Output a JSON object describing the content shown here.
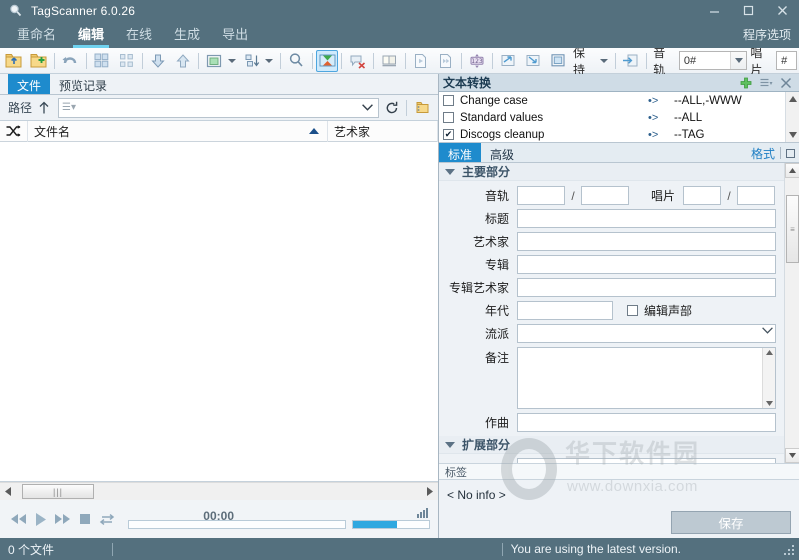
{
  "window": {
    "title": "TagScanner 6.0.26",
    "app_icon": "magnifier-icon",
    "minimize": "—",
    "maximize": "▢",
    "close": "✕"
  },
  "main_tabs": {
    "items": [
      {
        "label": "重命名",
        "active": false
      },
      {
        "label": "编辑",
        "active": true
      },
      {
        "label": "在线",
        "active": false
      },
      {
        "label": "生成",
        "active": false
      },
      {
        "label": "导出",
        "active": false
      }
    ],
    "options_label": "程序选项"
  },
  "toolbar": {
    "items": [
      {
        "name": "open-folder-icon",
        "title": "添加文件夹"
      },
      {
        "name": "add-folder-icon",
        "title": "添加文件"
      },
      {
        "name": "undo-icon",
        "title": "撤销"
      },
      {
        "name": "select-all-icon",
        "title": "全选"
      },
      {
        "name": "select-none-icon",
        "title": "取消选择"
      },
      {
        "name": "move-down-icon",
        "title": "下移"
      },
      {
        "name": "move-up-icon",
        "title": "上移"
      },
      {
        "name": "view-mode-icon",
        "title": "视图"
      },
      {
        "name": "sort-icon",
        "title": "排序"
      },
      {
        "name": "search-icon",
        "title": "查找"
      },
      {
        "name": "tag-convert-icon",
        "title": "文本转换",
        "selected": true
      },
      {
        "name": "remove-tag-icon",
        "title": "删除标签"
      },
      {
        "name": "playlist-icon",
        "title": "播放列表"
      },
      {
        "name": "play-file-icon",
        "title": "播放"
      },
      {
        "name": "play-list-icon",
        "title": "播放列表项"
      },
      {
        "name": "numbering-icon",
        "title": "自动编号"
      },
      {
        "name": "export-left-icon",
        "title": "导入"
      },
      {
        "name": "export-right-icon",
        "title": "导出"
      },
      {
        "name": "keep-icon",
        "title": "保持"
      },
      {
        "name": "apply-icon",
        "title": "应用"
      }
    ],
    "keep_label": "保持",
    "track_label": "音轨",
    "track_value": "0#",
    "disc_label": "唱片",
    "disc_value": "#"
  },
  "left_panel": {
    "tabs": [
      {
        "label": "文件",
        "active": true
      },
      {
        "label": "预览记录",
        "active": false
      }
    ],
    "path": {
      "label": "路径",
      "up_icon": "arrow-up-icon",
      "value": "",
      "placeholder": "",
      "dropdown_icon": "chevron-down-icon",
      "refresh_icon": "refresh-icon",
      "browse_icon": "browse-folder-icon"
    },
    "columns": [
      {
        "label": "",
        "icon": "shuffle-icon"
      },
      {
        "label": "文件名",
        "sorted": "asc"
      },
      {
        "label": "艺术家"
      }
    ],
    "rows": [],
    "hscroll": {
      "left_arrow": "◀",
      "right_arrow": "▶"
    }
  },
  "player": {
    "prev_icon": "rewind-icon",
    "play_icon": "play-icon",
    "next_icon": "fast-forward-icon",
    "stop_icon": "stop-icon",
    "repeat_icon": "repeat-icon",
    "time": "00:00",
    "seek_value": 0,
    "volume_value": 58,
    "volume_icon": "volume-bars-icon"
  },
  "text_convert": {
    "title": "文本转换",
    "add_icon": "plus-icon",
    "menu_icon": "list-menu-icon",
    "close_icon": "close-icon",
    "presets": [
      {
        "checked": false,
        "name": "Change case",
        "arrow": "•>",
        "mask": "--ALL,-WWW"
      },
      {
        "checked": false,
        "name": "Standard values",
        "arrow": "•>",
        "mask": "--ALL"
      },
      {
        "checked": true,
        "name": "Discogs cleanup",
        "arrow": "•>",
        "mask": "--TAG"
      }
    ]
  },
  "editor": {
    "tabs": [
      {
        "label": "标准",
        "active": true
      },
      {
        "label": "高级",
        "active": false
      }
    ],
    "format_link": "格式",
    "expand_icon": "square-icon",
    "main_section": {
      "title": "主要部分",
      "track_label": "音轨",
      "track_value": "",
      "track_total": "",
      "disc_label": "唱片",
      "disc_value": "",
      "disc_total": "",
      "title_label": "标题",
      "title_value": "",
      "artist_label": "艺术家",
      "artist_value": "",
      "album_label": "专辑",
      "album_value": "",
      "albumartist_label": "专辑艺术家",
      "albumartist_value": "",
      "year_label": "年代",
      "year_value": "",
      "edit_part_label": "编辑声部",
      "edit_part_checked": false,
      "genre_label": "流派",
      "genre_value": "",
      "comment_label": "备注",
      "comment_value": "",
      "composer_label": "作曲",
      "composer_value": ""
    },
    "extended_section": {
      "title": "扩展部分"
    },
    "tags_label": "标签",
    "info_text": "< No info >",
    "save_label": "保存"
  },
  "watermark": {
    "text": "华下软件园",
    "url": "www.downxia.com"
  },
  "statusbar": {
    "file_count": "0 个文件",
    "middle": "",
    "message": "You are using the latest version."
  },
  "colors": {
    "titlebar": "#54707e",
    "accent_tab": "#6fd2ef",
    "selected_tab": "#1e8bcd",
    "toolbar_selected": "#cfeafc",
    "volume_fill": "#2fa8e0"
  }
}
